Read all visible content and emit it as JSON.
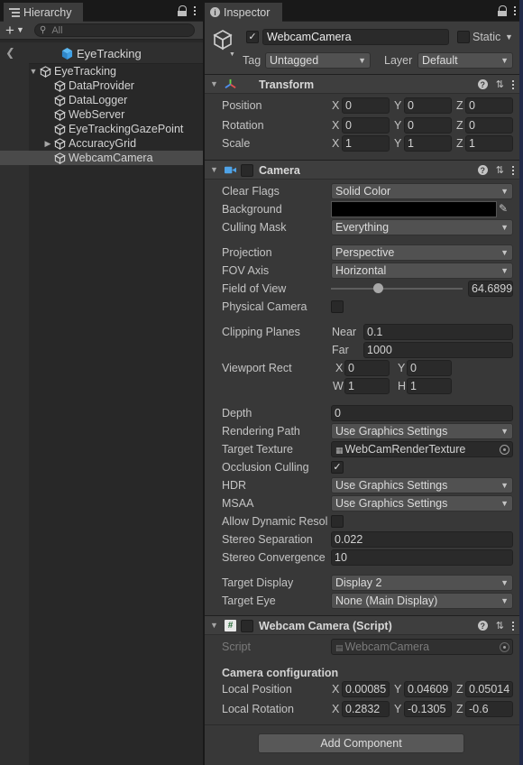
{
  "hierarchy": {
    "tab_label": "Hierarchy",
    "search_placeholder": "All",
    "scene_title": "EyeTracking",
    "items": [
      {
        "label": "EyeTracking"
      },
      {
        "label": "DataProvider"
      },
      {
        "label": "DataLogger"
      },
      {
        "label": "WebServer"
      },
      {
        "label": "EyeTrackingGazePoint"
      },
      {
        "label": "AccuracyGrid"
      },
      {
        "label": "WebcamCamera"
      }
    ]
  },
  "inspector": {
    "tab_label": "Inspector",
    "object_name": "WebcamCamera",
    "static_label": "Static",
    "tag_label": "Tag",
    "tag_value": "Untagged",
    "layer_label": "Layer",
    "layer_value": "Default",
    "transform": {
      "title": "Transform",
      "position_label": "Position",
      "rotation_label": "Rotation",
      "scale_label": "Scale",
      "position": {
        "x": "0",
        "y": "0",
        "z": "0"
      },
      "rotation": {
        "x": "0",
        "y": "0",
        "z": "0"
      },
      "scale": {
        "x": "1",
        "y": "1",
        "z": "1"
      }
    },
    "camera": {
      "title": "Camera",
      "clear_flags_label": "Clear Flags",
      "clear_flags": "Solid Color",
      "background_label": "Background",
      "culling_mask_label": "Culling Mask",
      "culling_mask": "Everything",
      "projection_label": "Projection",
      "projection": "Perspective",
      "fov_axis_label": "FOV Axis",
      "fov_axis": "Horizontal",
      "fov_label": "Field of View",
      "fov_value": "64.6899",
      "fov_slider_fraction": 0.36,
      "physical_camera_label": "Physical Camera",
      "clipping_label": "Clipping Planes",
      "near_label": "Near",
      "near": "0.1",
      "far_label": "Far",
      "far": "1000",
      "viewport_label": "Viewport Rect",
      "viewport": {
        "x": "0",
        "y": "0",
        "w": "1",
        "h": "1"
      },
      "depth_label": "Depth",
      "depth": "0",
      "rendering_path_label": "Rendering Path",
      "rendering_path": "Use Graphics Settings",
      "target_texture_label": "Target Texture",
      "target_texture": "WebCamRenderTexture",
      "occlusion_label": "Occlusion Culling",
      "hdr_label": "HDR",
      "hdr": "Use Graphics Settings",
      "msaa_label": "MSAA",
      "msaa": "Use Graphics Settings",
      "dyn_res_label": "Allow Dynamic Resol",
      "stereo_sep_label": "Stereo Separation",
      "stereo_sep": "0.022",
      "stereo_conv_label": "Stereo Convergence",
      "stereo_conv": "10",
      "target_display_label": "Target Display",
      "target_display": "Display 2",
      "target_eye_label": "Target Eye",
      "target_eye": "None (Main Display)"
    },
    "script_component": {
      "title": "Webcam Camera (Script)",
      "script_label": "Script",
      "script_value": "WebcamCamera",
      "section": "Camera configuration",
      "local_position_label": "Local Position",
      "local_position": {
        "x": "0.00085",
        "y": "0.04609",
        "z": "0.05014"
      },
      "local_rotation_label": "Local Rotation",
      "local_rotation": {
        "x": "0.2832",
        "y": "-0.1305",
        "z": "-0.6"
      }
    },
    "add_component_label": "Add Component"
  },
  "axes": {
    "x": "X",
    "y": "Y",
    "z": "Z",
    "w": "W",
    "h": "H"
  },
  "icons": [
    "hierarchy-icon",
    "lock-icon",
    "kebab-menu-icon",
    "plus-icon",
    "search-icon",
    "back-arrow-icon",
    "unity-scene-icon",
    "gameobject-icon",
    "foldout-arrow-icon",
    "inspector-icon",
    "transform-icon",
    "camera-icon",
    "script-icon",
    "help-icon",
    "presets-icon",
    "color-picker-icon",
    "object-picker-icon",
    "render-texture-icon"
  ],
  "colors": {
    "selection": "#4a4a4a",
    "panel": "#383838",
    "field": "#2a2a2a",
    "scene_icon": "#3fa0e6"
  }
}
